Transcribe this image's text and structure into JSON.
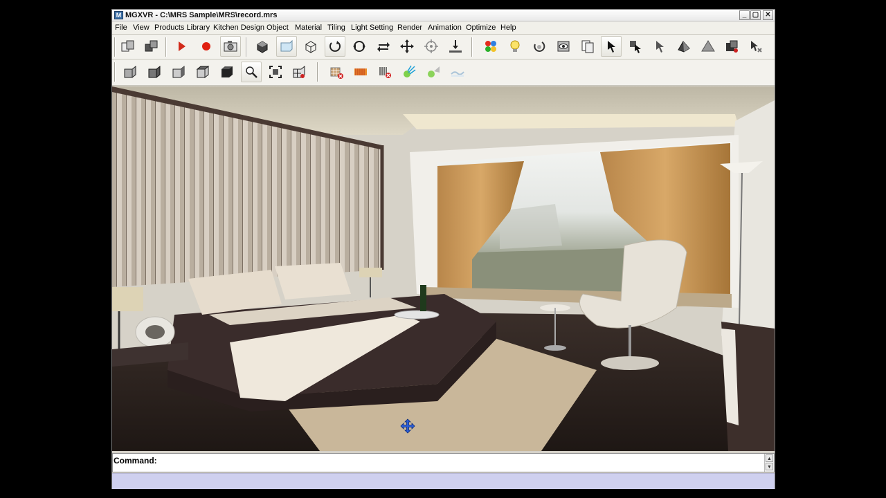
{
  "window": {
    "title": "MGXVR - C:\\MRS Sample\\MRS\\record.mrs",
    "icon_letter": "M",
    "minimize_label": "_",
    "maximize_label": "▢",
    "close_label": "✕"
  },
  "menu": {
    "items": [
      {
        "label": "File"
      },
      {
        "label": "View"
      },
      {
        "label": "Products Library"
      },
      {
        "label": "Kitchen Design"
      },
      {
        "label": "Object"
      },
      {
        "label": "Material"
      },
      {
        "label": "Tiling"
      },
      {
        "label": "Light Setting"
      },
      {
        "label": "Render"
      },
      {
        "label": "Animation"
      },
      {
        "label": "Optimize"
      },
      {
        "label": "Help"
      }
    ]
  },
  "toolbar1": {
    "icons": [
      "copy-object-icon",
      "paste-object-icon",
      "play-icon",
      "record-icon",
      "camera-icon",
      "box-view-icon",
      "front-view-icon",
      "wireframe-view-icon",
      "rotate-icon",
      "orbit-icon",
      "swap-icon",
      "pan-icon",
      "target-icon",
      "drop-to-floor-icon",
      "color-palette-icon",
      "light-bulb-icon",
      "rotate-light-icon",
      "eye-view-icon",
      "pages-icon",
      "select-arrow-icon",
      "select-object-icon",
      "select-pointer-icon",
      "prism-icon",
      "pyramid-icon",
      "group-icon",
      "deselect-icon"
    ]
  },
  "toolbar2": {
    "icons": [
      "cube-left-icon",
      "cube-solid-icon",
      "cube-right-icon",
      "cube-top-icon",
      "cube-dark-icon",
      "zoom-icon",
      "zoom-extents-icon",
      "grid-box-icon",
      "delete-texture-icon",
      "texture-strip-icon",
      "remove-lines-icon",
      "light-rays-icon",
      "spotlight-icon",
      "terrain-icon"
    ]
  },
  "viewport": {
    "scene": "rendered-bedroom-3d-view",
    "cursor_icon": "move-cursor-icon"
  },
  "command": {
    "label": "Command:",
    "value": "",
    "placeholder": ""
  },
  "colors": {
    "app_bg": "#d4d0c8",
    "status_bar": "#cfd0ef",
    "accent": "#3a6ea5"
  }
}
